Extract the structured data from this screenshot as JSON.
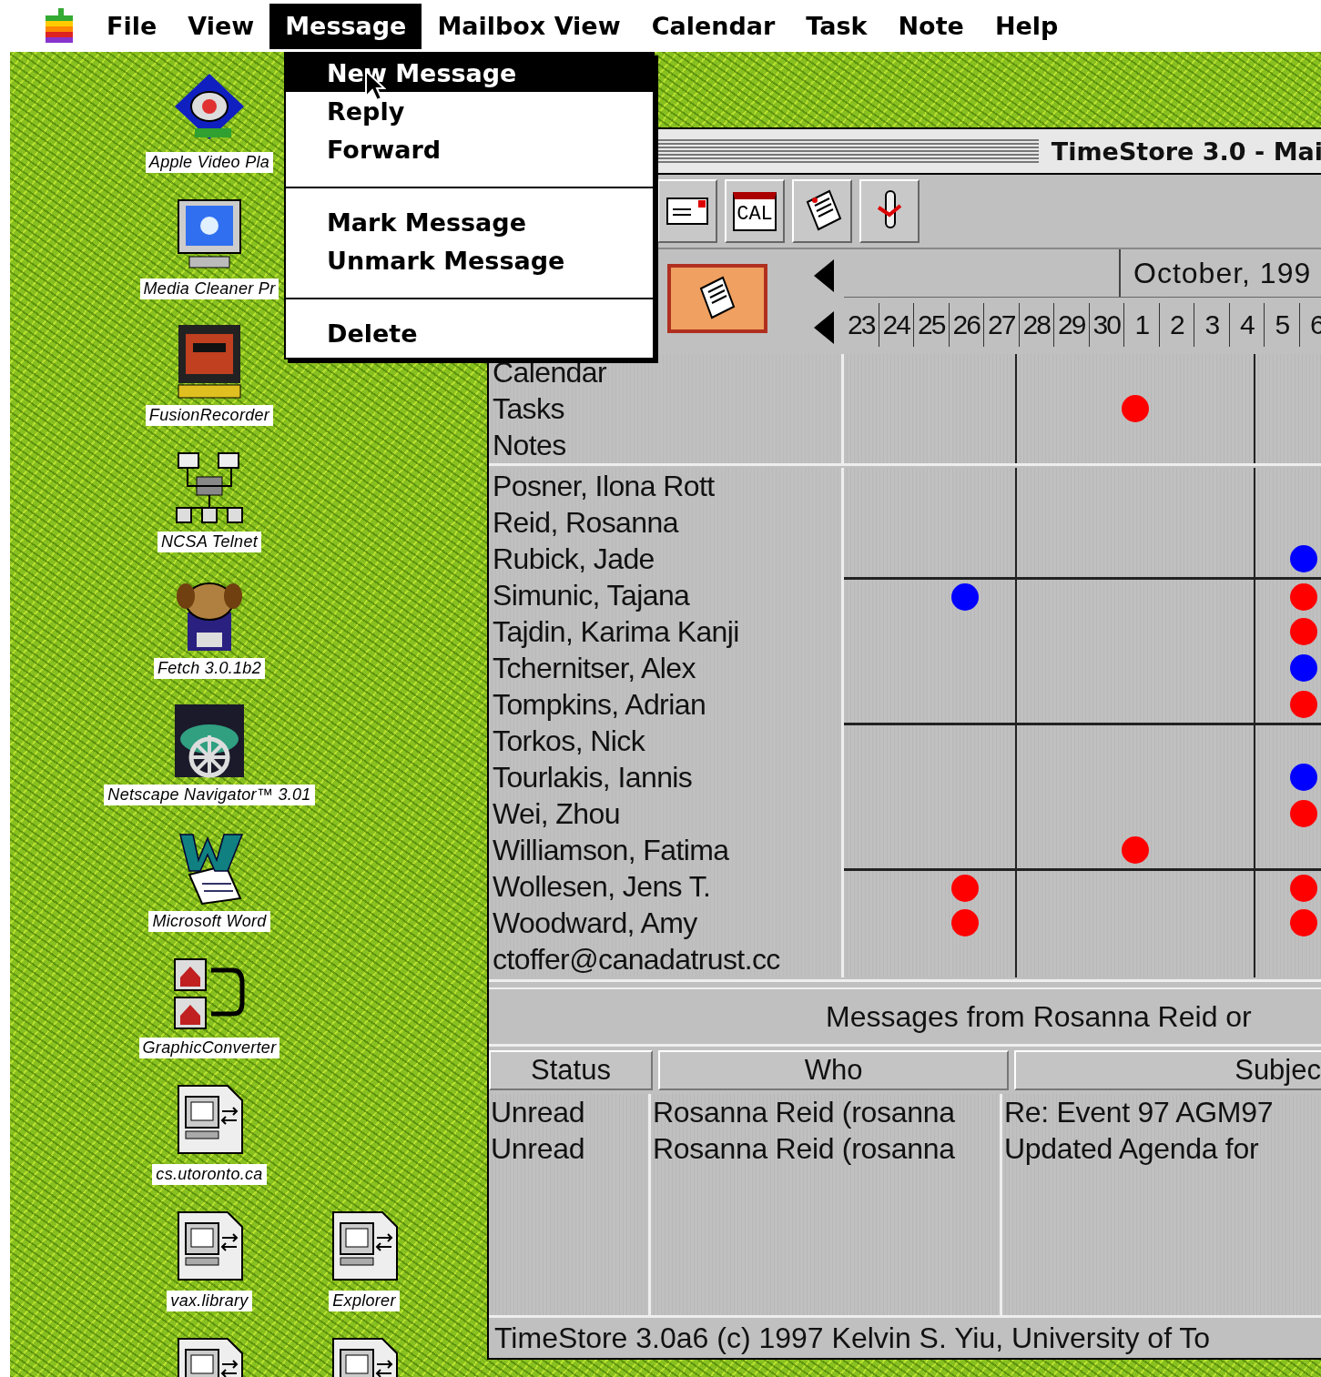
{
  "menu_bar": {
    "items": [
      {
        "label": "File",
        "selected": false
      },
      {
        "label": "View",
        "selected": false
      },
      {
        "label": "Message",
        "selected": true
      },
      {
        "label": "Mailbox View",
        "selected": false
      },
      {
        "label": "Calendar",
        "selected": false
      },
      {
        "label": "Task",
        "selected": false
      },
      {
        "label": "Note",
        "selected": false
      },
      {
        "label": "Help",
        "selected": false
      }
    ]
  },
  "menu": {
    "items": [
      {
        "kind": "item",
        "label": "New Message",
        "selected": true
      },
      {
        "kind": "item",
        "label": "Reply",
        "selected": false
      },
      {
        "kind": "item",
        "label": "Forward",
        "selected": false
      },
      {
        "kind": "separator"
      },
      {
        "kind": "item",
        "label": "Mark Message",
        "selected": false
      },
      {
        "kind": "item",
        "label": "Unmark Message",
        "selected": false
      },
      {
        "kind": "separator"
      },
      {
        "kind": "item",
        "label": "Delete",
        "selected": false
      }
    ]
  },
  "desktop_icons": [
    [
      {
        "kind": "video",
        "label": "Apple Video Pla"
      }
    ],
    [
      {
        "kind": "monitor",
        "label": "Media Cleaner Pr"
      }
    ],
    [
      {
        "kind": "recorder",
        "label": "FusionRecorder"
      }
    ],
    [
      {
        "kind": "network",
        "label": "NCSA Telnet"
      }
    ],
    [
      {
        "kind": "dog",
        "label": "Fetch 3.0.1b2"
      }
    ],
    [
      {
        "kind": "helm",
        "label": "Netscape Navigator™ 3.01"
      }
    ],
    [
      {
        "kind": "word",
        "label": "Microsoft Word"
      }
    ],
    [
      {
        "kind": "converter",
        "label": "GraphicConverter"
      }
    ],
    [
      {
        "kind": "terminal",
        "label": "cs.utoronto.ca"
      }
    ],
    [
      {
        "kind": "terminal",
        "label": "vax.library"
      },
      {
        "kind": "terminal",
        "label": "Explorer"
      }
    ],
    [
      {
        "kind": "terminal"
      },
      {
        "kind": "terminal"
      }
    ]
  ],
  "window": {
    "title": "TimeStore 3.0 - Mai",
    "toolbar": [
      {
        "kind": "mail"
      },
      {
        "kind": "cal",
        "label": "CAL"
      },
      {
        "kind": "note"
      },
      {
        "kind": "pin"
      }
    ],
    "calendar": {
      "month": "October, 199",
      "days": [
        "23",
        "24",
        "25",
        "26",
        "27",
        "28",
        "29",
        "30",
        "1",
        "2",
        "3",
        "4",
        "5",
        "6"
      ]
    },
    "groups": [
      {
        "rows": [
          {
            "label": "Calendar",
            "rule_above": false,
            "cells": [
              {
                "dot": false
              },
              {
                "dot": false
              },
              {
                "dot": false
              }
            ]
          },
          {
            "label": "Tasks",
            "rule_above": false,
            "cells": [
              {
                "dot": false
              },
              {
                "dot": true,
                "color": "#ff0000"
              },
              {
                "dot": false
              }
            ]
          },
          {
            "label": "Notes",
            "rule_above": false,
            "cells": [
              {
                "dot": false
              },
              {
                "dot": false
              },
              {
                "dot": false
              }
            ]
          }
        ]
      },
      {
        "rows": [
          {
            "label": "Posner, Ilona Rott",
            "rule_above": false,
            "cells": [
              {
                "dot": false
              },
              {
                "dot": false
              },
              {
                "dot": false
              }
            ]
          },
          {
            "label": "Reid, Rosanna",
            "rule_above": false,
            "cells": [
              {
                "dot": false
              },
              {
                "dot": false
              },
              {
                "dot": false
              }
            ]
          },
          {
            "label": "Rubick, Jade",
            "rule_above": false,
            "cells": [
              {
                "dot": false
              },
              {
                "dot": false
              },
              {
                "dot": true,
                "color": "#0000ff"
              }
            ]
          },
          {
            "label": "Simunic, Tajana",
            "rule_above": true,
            "cells": [
              {
                "dot": true,
                "color": "#0000ff"
              },
              {
                "dot": false
              },
              {
                "dot": true,
                "color": "#ff0000"
              }
            ]
          },
          {
            "label": "Tajdin, Karima Kanji",
            "rule_above": false,
            "cells": [
              {
                "dot": false
              },
              {
                "dot": false
              },
              {
                "dot": true,
                "color": "#ff0000"
              }
            ]
          },
          {
            "label": "Tchernitser, Alex",
            "rule_above": false,
            "cells": [
              {
                "dot": false
              },
              {
                "dot": false
              },
              {
                "dot": true,
                "color": "#0000ff"
              }
            ]
          },
          {
            "label": "Tompkins, Adrian",
            "rule_above": false,
            "cells": [
              {
                "dot": false
              },
              {
                "dot": false
              },
              {
                "dot": true,
                "color": "#ff0000"
              }
            ]
          },
          {
            "label": "Torkos, Nick",
            "rule_above": true,
            "cells": [
              {
                "dot": false
              },
              {
                "dot": false
              },
              {
                "dot": false
              }
            ]
          },
          {
            "label": "Tourlakis, Iannis",
            "rule_above": false,
            "cells": [
              {
                "dot": false
              },
              {
                "dot": false
              },
              {
                "dot": true,
                "color": "#0000ff"
              }
            ]
          },
          {
            "label": "Wei, Zhou",
            "rule_above": false,
            "cells": [
              {
                "dot": false
              },
              {
                "dot": false
              },
              {
                "dot": true,
                "color": "#ff0000"
              }
            ]
          },
          {
            "label": "Williamson, Fatima",
            "rule_above": false,
            "cells": [
              {
                "dot": false
              },
              {
                "dot": true,
                "color": "#ff0000"
              },
              {
                "dot": false
              }
            ]
          },
          {
            "label": "Wollesen, Jens T.",
            "rule_above": true,
            "cells": [
              {
                "dot": true,
                "color": "#ff0000"
              },
              {
                "dot": false
              },
              {
                "dot": true,
                "color": "#ff0000"
              }
            ]
          },
          {
            "label": "Woodward, Amy",
            "rule_above": false,
            "cells": [
              {
                "dot": true,
                "color": "#ff0000"
              },
              {
                "dot": false
              },
              {
                "dot": true,
                "color": "#ff0000"
              }
            ]
          },
          {
            "label": "ctoffer@canadatrust.cc",
            "rule_above": false,
            "cells": [
              {
                "dot": false
              },
              {
                "dot": false
              },
              {
                "dot": false
              }
            ]
          }
        ]
      }
    ],
    "messages": {
      "title": "Messages from Rosanna Reid or",
      "columns": [
        "Status",
        "Who",
        "Subjec"
      ],
      "rows": [
        [
          "Unread",
          "Rosanna Reid (rosanna",
          "Re: Event 97 AGM97"
        ],
        [
          "Unread",
          "Rosanna Reid (rosanna",
          "Updated Agenda for"
        ]
      ]
    },
    "status_bar": "TimeStore 3.0a6 (c) 1997 Kelvin S. Yiu, University of To"
  }
}
